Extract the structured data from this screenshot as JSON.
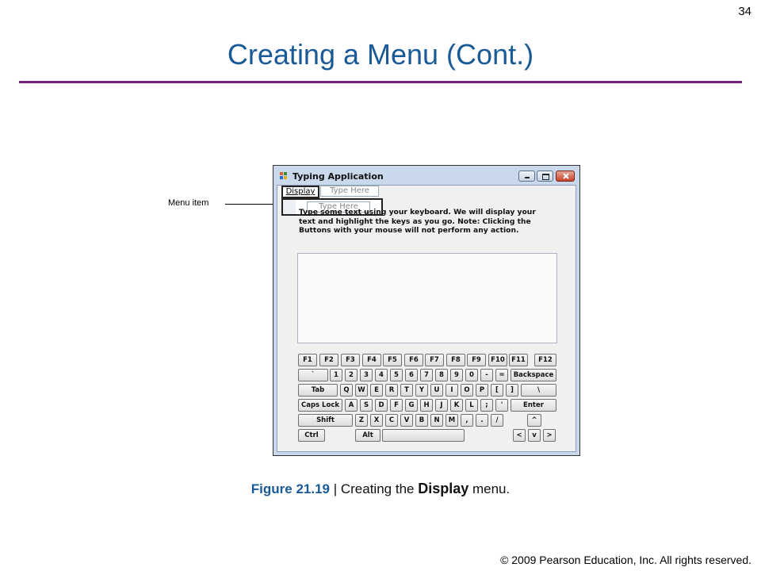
{
  "page_number": "34",
  "slide_title": "Creating a Menu (Cont.)",
  "callout": {
    "label": "Menu item"
  },
  "window": {
    "title": "Typing Application",
    "menu": {
      "display": "Display",
      "type_here_top": "Type Here",
      "type_here_dropdown": "Type Here"
    },
    "instructions": "Type some text using your keyboard. We will display your text and highlight the keys as you go. Note: Clicking the Buttons with your mouse will not perform any action."
  },
  "keyboard": {
    "row1": [
      "F1",
      "F2",
      "F3",
      "F4",
      "F5",
      "F6",
      "F7",
      "F8",
      "F9",
      "F10",
      "F11",
      "F12"
    ],
    "row2": [
      "`",
      "1",
      "2",
      "3",
      "4",
      "5",
      "6",
      "7",
      "8",
      "9",
      "0",
      "-",
      "=",
      "Backspace"
    ],
    "row3": [
      "Tab",
      "Q",
      "W",
      "E",
      "R",
      "T",
      "Y",
      "U",
      "I",
      "O",
      "P",
      "[",
      "]",
      "\\"
    ],
    "row4": [
      "Caps Lock",
      "A",
      "S",
      "D",
      "F",
      "G",
      "H",
      "J",
      "K",
      "L",
      ";",
      "'",
      "Enter"
    ],
    "row5": [
      "Shift",
      "Z",
      "X",
      "C",
      "V",
      "B",
      "N",
      "M",
      ",",
      ".",
      "/",
      "^"
    ],
    "row6": [
      "Ctrl",
      "Alt",
      "",
      "<",
      "v",
      ">"
    ]
  },
  "caption": {
    "figure": "Figure 21.19",
    "separator": " | Creating the ",
    "bold": "Display",
    "suffix": " menu."
  },
  "copyright": "© 2009 Pearson Education, Inc.  All rights reserved.",
  "colors": {
    "title": "#1a5a96",
    "rule": "#7b1f7e"
  }
}
